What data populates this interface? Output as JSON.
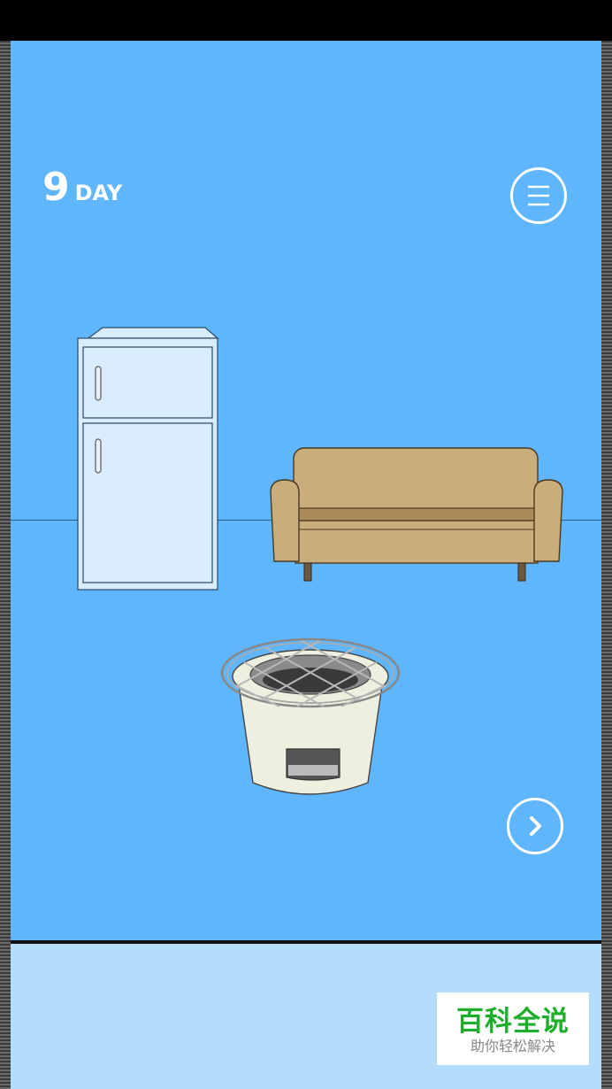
{
  "hud": {
    "day_number": "9",
    "day_word": "DAY"
  },
  "icons": {
    "menu": "hamburger-menu-icon",
    "next": "chevron-right-icon"
  },
  "scene": {
    "props": [
      "refrigerator",
      "sofa",
      "charcoal-brazier-with-grill"
    ]
  },
  "colors": {
    "background": "#5fb6fc",
    "inventory": "#b3dcfd",
    "fridge": "#d8ecfd",
    "sofa": "#c9ad7a",
    "brazier": "#efefe0"
  },
  "watermark": {
    "title": "百科全说",
    "subtitle": "助你轻松解决"
  }
}
